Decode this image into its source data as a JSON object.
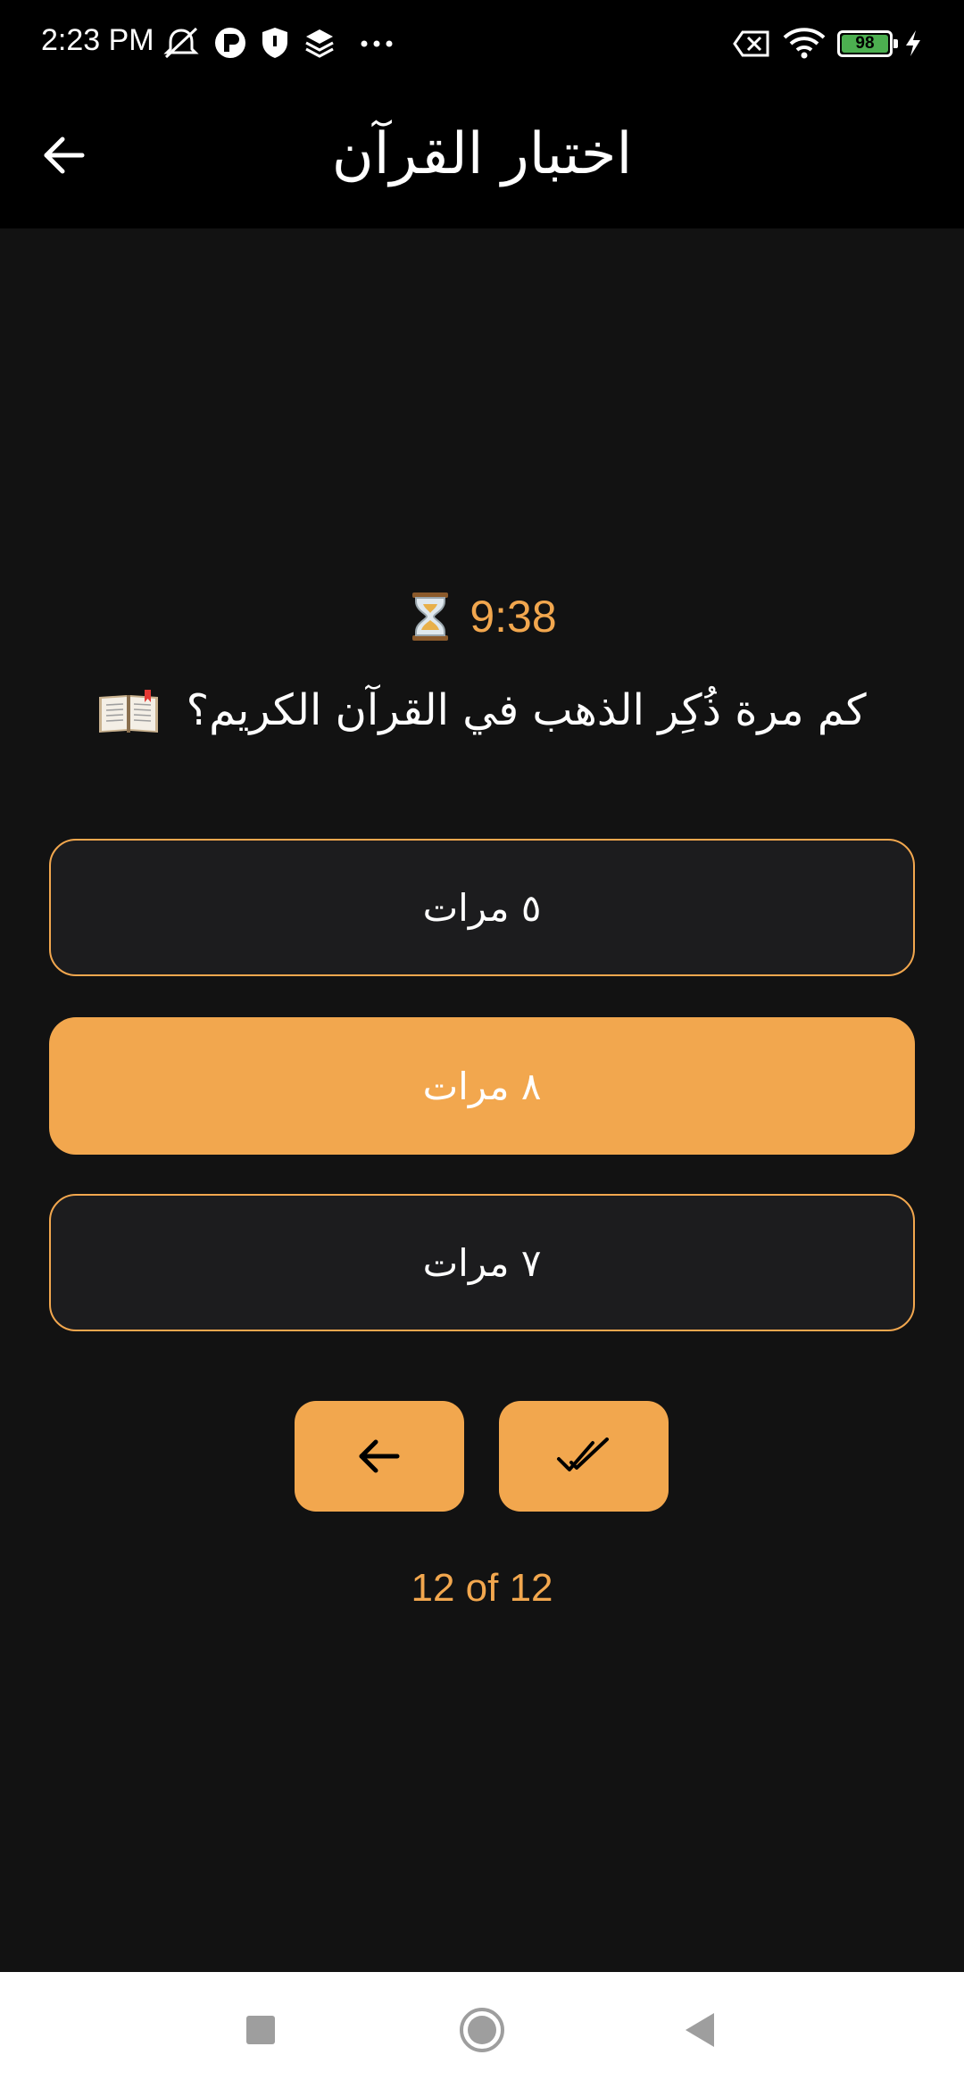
{
  "status_bar": {
    "time": "2:23 PM",
    "left_icons": [
      "mute-icon",
      "app-p-icon",
      "shield-icon",
      "layers-icon",
      "more-icon"
    ],
    "right_icons": [
      "sim-off-icon",
      "wifi-icon",
      "battery-icon",
      "charging-icon"
    ],
    "battery_level": "98"
  },
  "app_bar": {
    "title": "اختبار القرآن",
    "back_icon": "arrow-left-icon"
  },
  "quiz": {
    "timer": "9:38",
    "timer_icon": "hourglass-icon",
    "question": "كم مرة ذُكِر الذهب في القرآن الكريم؟",
    "question_icon": "open-book-icon",
    "options": [
      {
        "label": "٥ مرات",
        "state": "default"
      },
      {
        "label": "٨ مرات",
        "state": "selected"
      },
      {
        "label": "٧ مرات",
        "state": "default"
      }
    ],
    "previous_icon": "arrow-left-icon",
    "submit_icon": "double-check-icon",
    "progress": "12 of 12"
  },
  "colors": {
    "accent": "#f2a74e",
    "background": "#121212",
    "option_bg": "#1c1c1e",
    "battery_fill": "#4caf50"
  },
  "system_nav": [
    "recents-square-icon",
    "home-circle-icon",
    "back-triangle-icon"
  ]
}
